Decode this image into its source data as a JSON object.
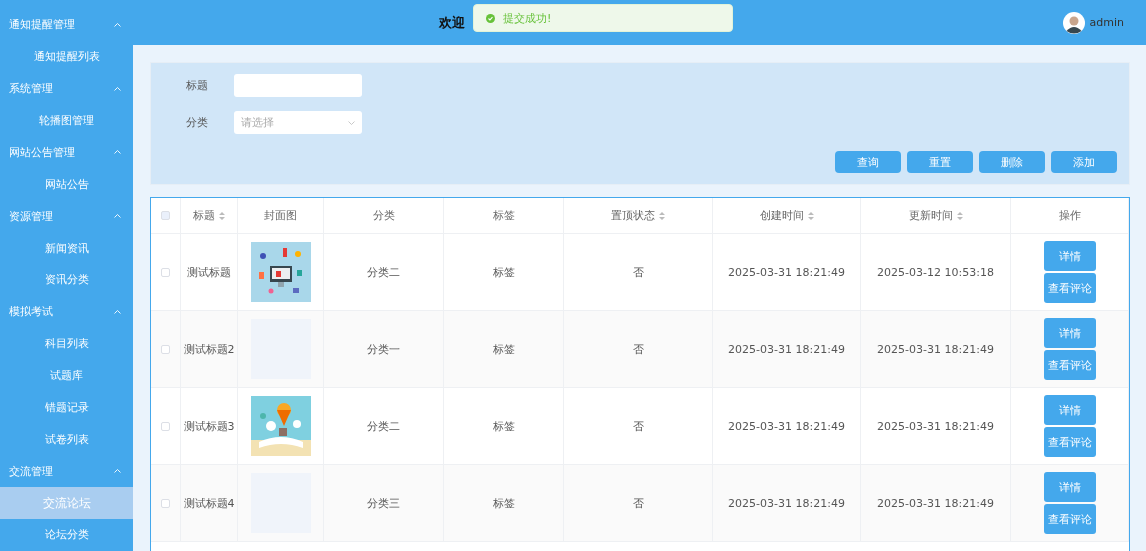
{
  "sidebar": {
    "groups": [
      {
        "label": "通知提醒管理",
        "expanded": true,
        "items": [
          {
            "label": "通知提醒列表",
            "selected": false
          }
        ]
      },
      {
        "label": "系统管理",
        "expanded": true,
        "items": [
          {
            "label": "轮播图管理",
            "selected": false
          }
        ]
      },
      {
        "label": "网站公告管理",
        "expanded": true,
        "items": [
          {
            "label": "网站公告",
            "selected": false
          }
        ]
      },
      {
        "label": "资源管理",
        "expanded": true,
        "items": [
          {
            "label": "新闻资讯",
            "selected": false
          },
          {
            "label": "资讯分类",
            "selected": false
          }
        ]
      },
      {
        "label": "模拟考试",
        "expanded": true,
        "items": [
          {
            "label": "科目列表",
            "selected": false
          },
          {
            "label": "试题库",
            "selected": false
          },
          {
            "label": "错题记录",
            "selected": false
          },
          {
            "label": "试卷列表",
            "selected": false
          }
        ]
      },
      {
        "label": "交流管理",
        "expanded": true,
        "items": [
          {
            "label": "交流论坛",
            "selected": true
          },
          {
            "label": "论坛分类",
            "selected": false
          }
        ]
      }
    ]
  },
  "header": {
    "title": "欢迎",
    "toast": "提交成功!",
    "user": "admin"
  },
  "search": {
    "fields": [
      {
        "kind": "input",
        "label": "标题"
      },
      {
        "kind": "select",
        "label": "分类",
        "placeholder": "请选择"
      }
    ],
    "buttons": [
      "查询",
      "重置",
      "删除",
      "添加"
    ]
  },
  "table": {
    "all_selected": false,
    "columns": [
      {
        "label": "标题",
        "sortable": true
      },
      {
        "label": "封面图",
        "sortable": false
      },
      {
        "label": "分类",
        "sortable": false
      },
      {
        "label": "标签",
        "sortable": false
      },
      {
        "label": "置顶状态",
        "sortable": true
      },
      {
        "label": "创建时间",
        "sortable": true
      },
      {
        "label": "更新时间",
        "sortable": true
      },
      {
        "label": "操作",
        "sortable": false
      }
    ],
    "rows": [
      {
        "selected": false,
        "title": "测试标题",
        "category": "分类二",
        "tag": "标签",
        "pinned": "否",
        "created": "2025-03-31 18:21:49",
        "updated": "2025-03-12 10:53:18",
        "actions": [
          "详情",
          "查看评论"
        ]
      },
      {
        "selected": false,
        "title": "测试标题2",
        "cover": {
          "kind": "empty"
        },
        "category": "分类一",
        "tag": "标签",
        "pinned": "否",
        "created": "2025-03-31 18:21:49",
        "updated": "2025-03-31 18:21:49",
        "actions": [
          "详情",
          "查看评论"
        ]
      },
      {
        "selected": false,
        "title": "测试标题3",
        "category": "分类二",
        "tag": "标签",
        "pinned": "否",
        "created": "2025-03-31 18:21:49",
        "updated": "2025-03-31 18:21:49",
        "actions": [
          "详情",
          "查看评论"
        ]
      },
      {
        "selected": false,
        "title": "测试标题4",
        "cover": {
          "kind": "empty"
        },
        "category": "分类三",
        "tag": "标签",
        "pinned": "否",
        "created": "2025-03-31 18:21:49",
        "updated": "2025-03-31 18:21:49",
        "actions": [
          "详情",
          "查看评论"
        ]
      }
    ]
  }
}
